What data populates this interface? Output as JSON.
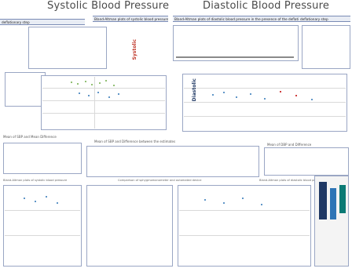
{
  "titles": {
    "left": "Systolic Blood Pressure",
    "right": "Diastolic Blood Pressure"
  },
  "headers": {
    "left_top": "Bland-Altman plots of systolic blood pressure in the presence of the deflationary step",
    "right_top": "Bland-Altman plots of diastolic blood pressure in the presence of the deflationary step",
    "left_sub": "deflationary step",
    "right_sub": "deflationary step"
  },
  "vertical_labels": {
    "left": "Systolic",
    "right": "Diastolic"
  },
  "mid_notes": {
    "left": "Mean of SBP and Mean Difference",
    "center": "Mean of SBP and Difference between the estimates",
    "right": "Mean of DBP and Difference"
  },
  "bottom_headers": {
    "left": "Bland-Altman plots of systolic blood pressure",
    "center": "Comparison of sphygmomanometer and automated device",
    "right": "Bland-Altman plots of diastolic blood pressure"
  },
  "colors": {
    "accent_red": "#c0392b",
    "line_blue": "#7a8bb5",
    "dot_blue": "#2e75b6",
    "dot_green": "#70ad47",
    "band_navy": "#1f3864"
  }
}
